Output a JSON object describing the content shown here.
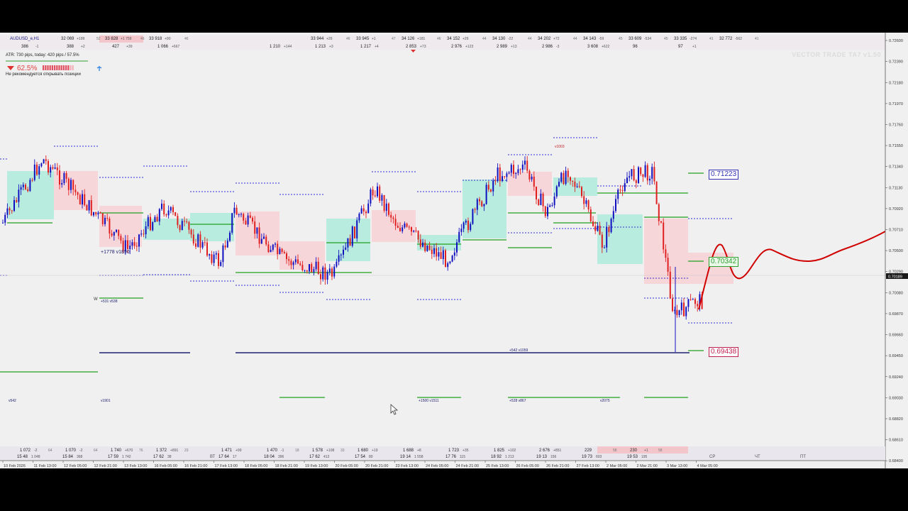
{
  "window": {
    "symbol": "AUDUSD_e,H1",
    "watermark": "VECTOR TRADE TA7 v1.50",
    "atr_text": "ATR: 730 pips, today: 420 pips / 57.5%",
    "signal_percent": "62.5%",
    "signal_note": "Не рекомендуется открывать позиции",
    "current_price": "0.70189"
  },
  "colors": {
    "bull": "#1010c0",
    "bear": "#e02020",
    "bull_zone": "#b8ecde",
    "bear_zone": "#f7d6da",
    "level_blue": "#3030d0",
    "level_green": "#20a020",
    "forecast": "#d00000",
    "navy_line": "#202070"
  },
  "top_stats": {
    "row1": [
      {
        "value": "32 069",
        "delta": "+199",
        "count": "52"
      },
      {
        "value": "33 828",
        "delta": "+1 759",
        "count": "46"
      },
      {
        "value": "33 918",
        "delta": "+90",
        "count": "46"
      },
      {
        "value": "33 944",
        "delta": "+26",
        "count": "46"
      },
      {
        "value": "33 945",
        "delta": "+1",
        "count": "47"
      },
      {
        "value": "34 126",
        "delta": "+181",
        "count": "46"
      },
      {
        "value": "34 152",
        "delta": "+26",
        "count": "44"
      },
      {
        "value": "34 130",
        "delta": "-22",
        "count": "44"
      },
      {
        "value": "34 202",
        "delta": "+72",
        "count": "44"
      },
      {
        "value": "34 143",
        "delta": "-59",
        "count": "45"
      },
      {
        "value": "33 609",
        "delta": "-534",
        "count": "45"
      },
      {
        "value": "33 335",
        "delta": "-274",
        "count": "41"
      },
      {
        "value": "32 772",
        "delta": "-562",
        "count": "41"
      }
    ],
    "row2": [
      {
        "value": "386",
        "delta": "-1"
      },
      {
        "value": "388",
        "delta": "+2"
      },
      {
        "value": "427",
        "delta": "+39"
      },
      {
        "value": "1 066",
        "delta": "+667"
      },
      {
        "value": "1 210",
        "delta": "+144"
      },
      {
        "value": "1 213",
        "delta": "+3"
      },
      {
        "value": "1 217",
        "delta": "+4"
      },
      {
        "value": "2 853",
        "delta": "+73"
      },
      {
        "value": "2 976",
        "delta": "+123"
      },
      {
        "value": "2 989",
        "delta": "+13"
      },
      {
        "value": "2 986",
        "delta": "-3"
      },
      {
        "value": "3 608",
        "delta": "+622"
      },
      {
        "value": "96",
        "delta": ""
      },
      {
        "value": "97",
        "delta": "+1"
      }
    ]
  },
  "price_axis": {
    "ticks": [
      "0.72600",
      "0.72390",
      "0.72180",
      "0.71970",
      "0.71760",
      "0.71550",
      "0.71340",
      "0.71130",
      "0.70920",
      "0.70710",
      "0.70500",
      "0.70290",
      "0.70080",
      "0.69870",
      "0.69660",
      "0.69450",
      "0.69240",
      "0.69030",
      "0.68820",
      "0.68610",
      "0.68400"
    ],
    "tick_values": [
      0.726,
      0.7239,
      0.7218,
      0.7197,
      0.7176,
      0.7155,
      0.7134,
      0.7113,
      0.7092,
      0.7071,
      0.705,
      0.7029,
      0.7008,
      0.6987,
      0.6966,
      0.6945,
      0.6924,
      0.6903,
      0.6882,
      0.6861,
      0.684
    ],
    "max": 0.7265,
    "min": 0.6838
  },
  "time_axis": {
    "labels": [
      "10 Feb 2026",
      "11 Feb 13:00",
      "12 Feb 05:00",
      "12 Feb 21:00",
      "13 Feb 13:00",
      "16 Feb 05:00",
      "16 Feb 21:00",
      "17 Feb 13:00",
      "18 Feb 05:00",
      "18 Feb 21:00",
      "19 Feb 13:00",
      "20 Feb 05:00",
      "20 Feb 21:00",
      "23 Feb 13:00",
      "24 Feb 05:00",
      "24 Feb 21:00",
      "25 Feb 13:00",
      "26 Feb 05:00",
      "26 Feb 21:00",
      "27 Feb 13:00",
      "2 Mar 05:00",
      "2 Mar 21:00",
      "3 Mar 13:00",
      "4 Mar 05:00"
    ],
    "weekdays": [
      "ВТ",
      "СР",
      "ЧТ",
      "ПТ"
    ]
  },
  "bottom_stats": [
    {
      "value": "1 072",
      "delta": "-2",
      "count": "64"
    },
    {
      "value": "1 070",
      "delta": "-2",
      "count": "64"
    },
    {
      "value": "1 740",
      "delta": "+670",
      "count": "76"
    },
    {
      "value": "1 372",
      "delta": "+891",
      "count": "23"
    },
    {
      "value": "1 471",
      "delta": "+99",
      "count": ""
    },
    {
      "value": "1 470",
      "delta": "-1",
      "count": "18"
    },
    {
      "value": "1 578",
      "delta": "+108",
      "count": "33"
    },
    {
      "value": "1 680",
      "delta": "+19",
      "count": ""
    },
    {
      "value": "1 688",
      "delta": "+8",
      "count": ""
    },
    {
      "value": "1 723",
      "delta": "+35",
      "count": ""
    },
    {
      "value": "1 825",
      "delta": "+102",
      "count": ""
    },
    {
      "value": "2 676",
      "delta": "+851",
      "count": ""
    },
    {
      "value": "229",
      "delta": "",
      "count": "58"
    },
    {
      "value": "230",
      "delta": "+1",
      "count": "58"
    }
  ],
  "bottom_row2": [
    {
      "value": "15 48",
      "delta": "1 048"
    },
    {
      "value": "15 84",
      "delta": "368"
    },
    {
      "value": "17 59",
      "delta": "1 742"
    },
    {
      "value": "17 62",
      "delta": "38"
    },
    {
      "value": "17 64",
      "delta": "17"
    },
    {
      "value": "18 04",
      "delta": "396"
    },
    {
      "value": "17 62",
      "delta": "413"
    },
    {
      "value": "17 54",
      "delta": "80"
    },
    {
      "value": "19 14",
      "delta": "1 558"
    },
    {
      "value": "17 76",
      "delta": "115"
    },
    {
      "value": "18 92",
      "delta": "1 213"
    },
    {
      "value": "19 13",
      "delta": "156"
    },
    {
      "value": "19 73",
      "delta": "603"
    },
    {
      "value": "19 53",
      "delta": "195"
    }
  ],
  "annotations": {
    "vol_left": "+1778 v1890",
    "vol_w": "W",
    "vol_w2": "+531 v538",
    "v1003": "v1003",
    "v1059": "+542 v1059",
    "v542": "v542",
    "v1901": "v1901",
    "v1511": "+1500 v1511",
    "v867": "+528 v867",
    "v2075": "v2075"
  },
  "price_labels": {
    "upper": "0.71223",
    "middle": "0.70342",
    "lower": "0.69438"
  }
}
